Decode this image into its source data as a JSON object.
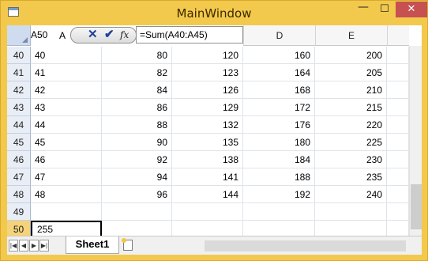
{
  "window": {
    "title": "MainWindow",
    "min_label": "—",
    "max_label": "☐",
    "close_label": "✕"
  },
  "formula_bar": {
    "name_box": "A50",
    "column_label": "A",
    "cancel": "✕",
    "commit": "✔",
    "fx": "fx",
    "formula": "=Sum(A40:A45)"
  },
  "col_headers": [
    "D",
    "E"
  ],
  "rows": [
    {
      "num": "40",
      "a": "40",
      "b": "80",
      "c": "120",
      "d": "160",
      "e": "200"
    },
    {
      "num": "41",
      "a": "41",
      "b": "82",
      "c": "123",
      "d": "164",
      "e": "205"
    },
    {
      "num": "42",
      "a": "42",
      "b": "84",
      "c": "126",
      "d": "168",
      "e": "210"
    },
    {
      "num": "43",
      "a": "43",
      "b": "86",
      "c": "129",
      "d": "172",
      "e": "215"
    },
    {
      "num": "44",
      "a": "44",
      "b": "88",
      "c": "132",
      "d": "176",
      "e": "220"
    },
    {
      "num": "45",
      "a": "45",
      "b": "90",
      "c": "135",
      "d": "180",
      "e": "225"
    },
    {
      "num": "46",
      "a": "46",
      "b": "92",
      "c": "138",
      "d": "184",
      "e": "230"
    },
    {
      "num": "47",
      "a": "47",
      "b": "94",
      "c": "141",
      "d": "188",
      "e": "235"
    },
    {
      "num": "48",
      "a": "48",
      "b": "96",
      "c": "144",
      "d": "192",
      "e": "240"
    },
    {
      "num": "49",
      "a": "",
      "b": "",
      "c": "",
      "d": "",
      "e": ""
    },
    {
      "num": "50",
      "a": "255",
      "b": "",
      "c": "",
      "d": "",
      "e": ""
    }
  ],
  "nav": {
    "first": "|◀",
    "prev": "◀",
    "next": "▶",
    "last": "▶|"
  },
  "sheet_tab": "Sheet1",
  "colors": {
    "titlebar": "#f2c94c",
    "close": "#c75050",
    "selected_row_header": "#f5d37a"
  }
}
